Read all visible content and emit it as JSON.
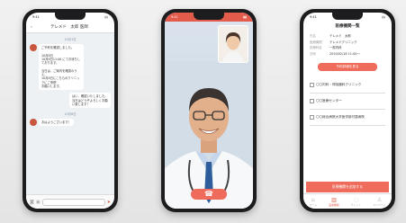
{
  "chat": {
    "time": "9:41",
    "title": "テレメド　太郎 医師",
    "date1": "10月1日",
    "msg1": "ご予約を確認しました。\n\n10月8日\n10月8日11:00 にてお待ちしております。\n\n当日は、ご案内を確認のうえ、\n10月8日にこちらのクリニックにご来院\nお願いします。",
    "msg2": "はい、確認いたしました。\n当日はどうぞよろしくお願い致します！",
    "date2": "10月8日",
    "msg3": "おはようございます！",
    "icons": {
      "back": "back-arrow-icon",
      "camera": "camera-icon",
      "image": "image-icon",
      "send": "send-icon"
    }
  },
  "video": {
    "time": "9:41",
    "hangup_icon": "phone-hangup-icon"
  },
  "list": {
    "time": "9:41",
    "title": "医療機関一覧",
    "rows": [
      {
        "k": "氏名",
        "v": "テレメド　太郎"
      },
      {
        "k": "医療機関",
        "v": "テレメドクリニック"
      },
      {
        "k": "診療科目",
        "v": "一般内科"
      },
      {
        "k": "日時",
        "v": "2020/02/18 11:00〜"
      }
    ],
    "detail_button": "予約詳細を見る",
    "options": [
      "〇〇内科・呼吸器科クリニック",
      "〇〇医療センター",
      "〇〇総合病院大学医学部付属病院"
    ],
    "main_button": "医療機関を追加する",
    "tabs": [
      {
        "label": "ホーム",
        "icon": "home-icon"
      },
      {
        "label": "医療機関",
        "icon": "hospital-icon"
      },
      {
        "label": "チャット",
        "icon": "chat-icon"
      },
      {
        "label": "マイページ",
        "icon": "user-icon"
      }
    ]
  }
}
